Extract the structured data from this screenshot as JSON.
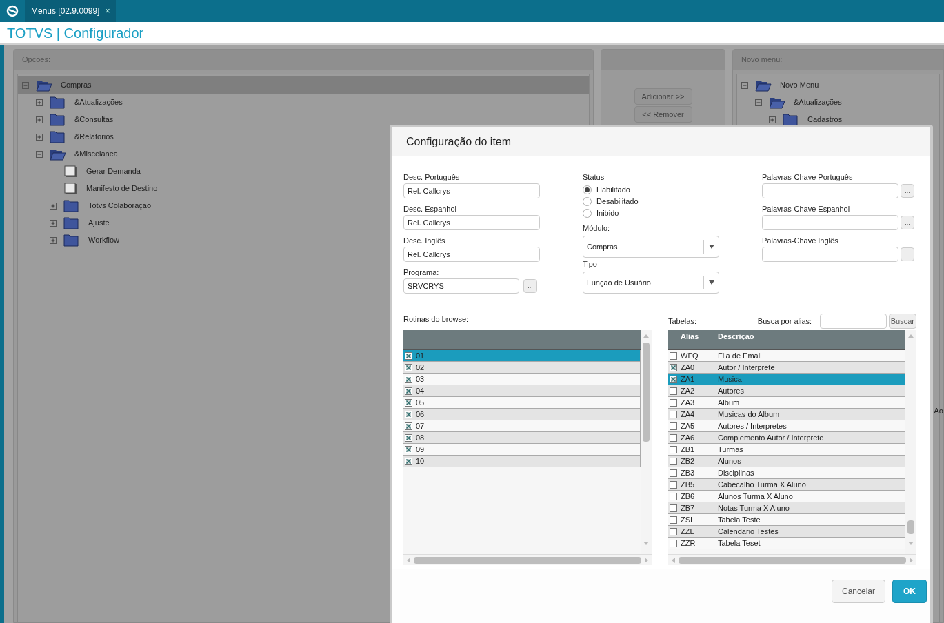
{
  "app_tab": {
    "label": "Menus [02.9.0099]",
    "close": "×"
  },
  "title": "TOTVS | Configurador",
  "options_panel": {
    "label": "Opcoes:",
    "tree": [
      {
        "label": "Compras",
        "kind": "folder",
        "expanded": true,
        "selected": true,
        "children": [
          {
            "label": "&Atualizações",
            "kind": "folder",
            "expanded": false,
            "selected": false
          },
          {
            "label": "&Consultas",
            "kind": "folder",
            "expanded": false,
            "selected": false
          },
          {
            "label": "&Relatorios",
            "kind": "folder",
            "expanded": false,
            "selected": false
          },
          {
            "label": "&Miscelanea",
            "kind": "folder",
            "expanded": true,
            "selected": false,
            "children": [
              {
                "label": "Gerar Demanda",
                "kind": "item",
                "selected": false
              },
              {
                "label": "Manifesto de Destino",
                "kind": "item",
                "selected": false
              },
              {
                "label": "Totvs Colaboração",
                "kind": "folder",
                "expanded": false,
                "selected": false
              },
              {
                "label": "Ajuste",
                "kind": "folder",
                "expanded": false,
                "selected": false
              },
              {
                "label": "Workflow",
                "kind": "folder",
                "expanded": false,
                "selected": false
              }
            ]
          }
        ]
      }
    ]
  },
  "move_buttons": [
    "Adicionar >>",
    "<< Remover"
  ],
  "new_menu_panel": {
    "label": "Novo menu:",
    "tree": [
      {
        "label": "Novo Menu",
        "kind": "folder",
        "expanded": true,
        "selected": false,
        "children": [
          {
            "label": "&Atualizações",
            "kind": "folder",
            "expanded": true,
            "selected": false,
            "children": [
              {
                "label": "Cadastros",
                "kind": "folder",
                "expanded": false,
                "selected": false
              }
            ]
          }
        ]
      }
    ],
    "side_text": "Ao"
  },
  "dialog": {
    "title": "Configuração do item",
    "desc_fields": [
      {
        "label": "Desc. Português",
        "value": "Rel. Callcrys"
      },
      {
        "label": "Desc. Espanhol",
        "value": "Rel. Callcrys"
      },
      {
        "label": "Desc. Inglês",
        "value": "Rel. Callcrys"
      }
    ],
    "program": {
      "label": "Programa:",
      "value": "SRVCRYS",
      "button": "..."
    },
    "status": {
      "label": "Status",
      "options": [
        {
          "label": "Habilitado",
          "selected": true
        },
        {
          "label": "Desabilitado",
          "selected": false
        },
        {
          "label": "Inibido",
          "selected": false
        }
      ]
    },
    "selects": [
      {
        "label": "Módulo:",
        "value": "Compras"
      },
      {
        "label": "Tipo",
        "value": "Função de Usuário"
      }
    ],
    "keyword_fields": [
      {
        "label": "Palavras-Chave Português",
        "button": "..."
      },
      {
        "label": "Palavras-Chave Espanhol",
        "button": "..."
      },
      {
        "label": "Palavras-Chave Inglês",
        "button": "..."
      }
    ],
    "routines": {
      "label": "Rotinas do browse:",
      "rows": [
        {
          "value": "01",
          "checked": true,
          "selected": true
        },
        {
          "value": "02",
          "checked": true,
          "selected": false
        },
        {
          "value": "03",
          "checked": true,
          "selected": false
        },
        {
          "value": "04",
          "checked": true,
          "selected": false
        },
        {
          "value": "05",
          "checked": true,
          "selected": false
        },
        {
          "value": "06",
          "checked": true,
          "selected": false
        },
        {
          "value": "07",
          "checked": true,
          "selected": false
        },
        {
          "value": "08",
          "checked": true,
          "selected": false
        },
        {
          "value": "09",
          "checked": true,
          "selected": false
        },
        {
          "value": "10",
          "checked": true,
          "selected": false
        }
      ]
    },
    "tables": {
      "label": "Tabelas:",
      "search_label": "Busca por alias:",
      "search_button": "Buscar",
      "columns": [
        "Alias",
        "Descrição"
      ],
      "rows": [
        {
          "alias": "WFQ",
          "description": "Fila de Email",
          "checked": false,
          "selected": false
        },
        {
          "alias": "ZA0",
          "description": "Autor / Interprete",
          "checked": true,
          "selected": false
        },
        {
          "alias": "ZA1",
          "description": "Musica",
          "checked": true,
          "selected": true
        },
        {
          "alias": "ZA2",
          "description": "Autores",
          "checked": false,
          "selected": false
        },
        {
          "alias": "ZA3",
          "description": "Album",
          "checked": false,
          "selected": false
        },
        {
          "alias": "ZA4",
          "description": "Musicas do Album",
          "checked": false,
          "selected": false
        },
        {
          "alias": "ZA5",
          "description": "Autores / Interpretes",
          "checked": false,
          "selected": false
        },
        {
          "alias": "ZA6",
          "description": "Complemento Autor / Interprete",
          "checked": false,
          "selected": false
        },
        {
          "alias": "ZB1",
          "description": "Turmas",
          "checked": false,
          "selected": false
        },
        {
          "alias": "ZB2",
          "description": "Alunos",
          "checked": false,
          "selected": false
        },
        {
          "alias": "ZB3",
          "description": "Disciplinas",
          "checked": false,
          "selected": false
        },
        {
          "alias": "ZB5",
          "description": "Cabecalho Turma X Aluno",
          "checked": false,
          "selected": false
        },
        {
          "alias": "ZB6",
          "description": "Alunos Turma X Aluno",
          "checked": false,
          "selected": false
        },
        {
          "alias": "ZB7",
          "description": "Notas Turma X Aluno",
          "checked": false,
          "selected": false
        },
        {
          "alias": "ZSI",
          "description": "Tabela Teste",
          "checked": false,
          "selected": false
        },
        {
          "alias": "ZZL",
          "description": "Calendario Testes",
          "checked": false,
          "selected": false
        },
        {
          "alias": "ZZR",
          "description": "Tabela Teset",
          "checked": false,
          "selected": false
        }
      ]
    },
    "buttons": [
      {
        "label": "Cancelar",
        "kind": "secondary"
      },
      {
        "label": "OK",
        "kind": "primary"
      }
    ]
  }
}
